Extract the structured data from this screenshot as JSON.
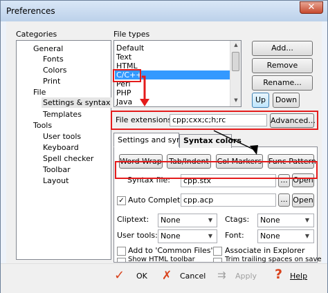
{
  "window": {
    "title": "Preferences",
    "close_glyph": "✕"
  },
  "categories": {
    "label": "Categories",
    "items": [
      "General",
      "Fonts",
      "Colors",
      "Print",
      "File",
      "Settings & syntax",
      "Templates",
      "Tools",
      "User tools",
      "Keyboard",
      "Spell checker",
      "Toolbar",
      "Layout"
    ]
  },
  "file_types": {
    "label": "File types",
    "items": [
      "Default",
      "Text",
      "HTML",
      "C/C++",
      "Perl",
      "PHP",
      "Java"
    ]
  },
  "side_buttons": {
    "add": "Add...",
    "remove": "Remove",
    "rename": "Rename...",
    "up": "Up",
    "down": "Down"
  },
  "extensions": {
    "label": "File extensions:",
    "value": "cpp;cxx;c;h;rc",
    "advanced": "Advanced..."
  },
  "tabs": {
    "settings": "Settings and syntax",
    "colors": "Syntax colors"
  },
  "tool_buttons": {
    "word_wrap": "Word Wrap",
    "tab_indent": "Tab/Indent",
    "col_markers": "Col Markers",
    "func_pattern": "Func Pattern"
  },
  "syntax": {
    "label": "Syntax file:",
    "value": "cpp.stx",
    "browse": "...",
    "open": "Open"
  },
  "autocomplete": {
    "label": "Auto Completion:",
    "checked": true,
    "value": "cpp.acp",
    "browse": "...",
    "open": "Open"
  },
  "combos": {
    "cliptext": {
      "label": "Cliptext:",
      "value": "None"
    },
    "ctags": {
      "label": "Ctags:",
      "value": "None"
    },
    "user_tools": {
      "label": "User tools:",
      "value": "None"
    },
    "font": {
      "label": "Font:",
      "value": "None"
    }
  },
  "checks": {
    "common_files": "Add to 'Common Files'",
    "show_toolbar": "Show HTML toolbar",
    "associate": "Associate in Explorer",
    "trim": "Trim trailing spaces on save"
  },
  "footer": {
    "ok": "OK",
    "cancel": "Cancel",
    "apply": "Apply",
    "help": "Help"
  },
  "colors": {
    "highlight": "#e41b1b",
    "selection": "#3399ff"
  }
}
